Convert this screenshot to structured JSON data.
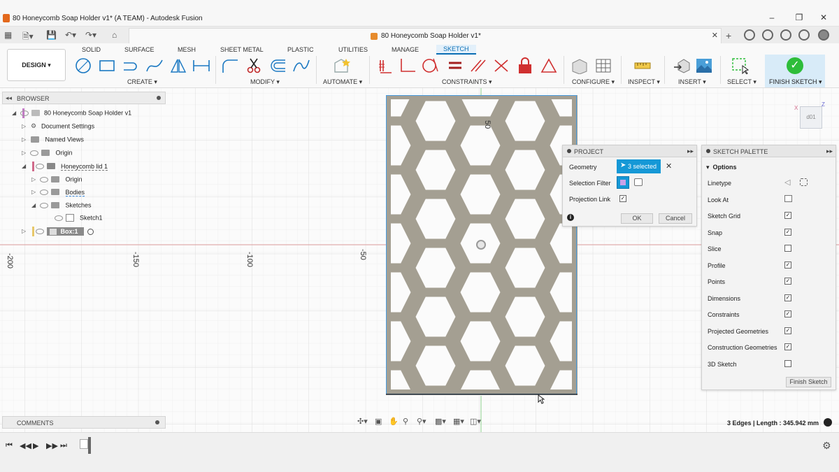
{
  "window": {
    "title": "80 Honeycomb Soap Holder v1* (A TEAM) - Autodesk Fusion",
    "controls": [
      "minimize",
      "maximize",
      "close"
    ]
  },
  "document_tab": {
    "name": "80 Honeycomb Soap Holder v1*"
  },
  "ribbon": {
    "workspace": "DESIGN",
    "tabs": [
      "SOLID",
      "SURFACE",
      "MESH",
      "SHEET METAL",
      "PLASTIC",
      "UTILITIES",
      "MANAGE",
      "SKETCH"
    ],
    "active_tab": "SKETCH",
    "groups": {
      "create": "CREATE",
      "modify": "MODIFY",
      "automate": "AUTOMATE",
      "constraints": "CONSTRAINTS",
      "configure": "CONFIGURE",
      "inspect": "INSPECT",
      "insert": "INSERT",
      "select": "SELECT",
      "finish": "FINISH SKETCH"
    },
    "constraint_color": "#d03030"
  },
  "browser": {
    "title": "BROWSER",
    "items": [
      {
        "label": "80 Honeycomb Soap Holder v1"
      },
      {
        "label": "Document Settings"
      },
      {
        "label": "Named Views"
      },
      {
        "label": "Origin"
      },
      {
        "label": "Honeycomb lid 1"
      },
      {
        "label": "Origin"
      },
      {
        "label": "Bodies"
      },
      {
        "label": "Sketches"
      },
      {
        "label": "Sketch1"
      },
      {
        "label": "Box:1"
      }
    ]
  },
  "axis_labels": [
    "-200",
    "-150",
    "-100",
    "-50",
    "50"
  ],
  "project_dialog": {
    "title": "PROJECT",
    "geometry_label": "Geometry",
    "selection_value": "3 selected",
    "selection_filter_label": "Selection Filter",
    "projection_link_label": "Projection Link",
    "ok_label": "OK",
    "cancel_label": "Cancel"
  },
  "sketch_palette": {
    "title": "SKETCH PALETTE",
    "section": "Options",
    "linetype_label": "Linetype",
    "look_at_label": "Look At",
    "options": [
      {
        "label": "Sketch Grid",
        "checked": true
      },
      {
        "label": "Snap",
        "checked": true
      },
      {
        "label": "Slice",
        "checked": false
      },
      {
        "label": "Profile",
        "checked": true
      },
      {
        "label": "Points",
        "checked": true
      },
      {
        "label": "Dimensions",
        "checked": true
      },
      {
        "label": "Constraints",
        "checked": true
      },
      {
        "label": "Projected Geometries",
        "checked": true
      },
      {
        "label": "Construction Geometries",
        "checked": true
      },
      {
        "label": "3D Sketch",
        "checked": false
      }
    ],
    "finish_label": "Finish Sketch"
  },
  "comments": {
    "title": "COMMENTS"
  },
  "status": {
    "text": "3 Edges | Length : 345.942 mm"
  },
  "viewcube": {
    "label": "d01"
  },
  "colors": {
    "selection_blue": "#1598d6",
    "finish_green": "#2ebd3a",
    "lattice": "#a49f92",
    "axis_red": "#d99a9a",
    "axis_green": "#8fd08f"
  }
}
